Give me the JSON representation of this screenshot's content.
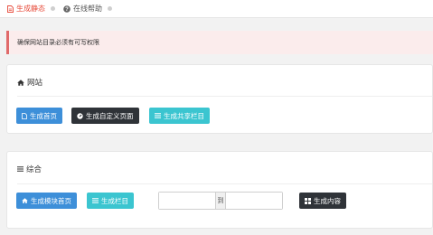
{
  "tabs": {
    "active_label": "生成静态",
    "help_label": "在线帮助"
  },
  "alert": {
    "text": "确保网站目录必须有可写权限"
  },
  "panel_site": {
    "title": "网站",
    "buttons": {
      "home": "生成首页",
      "custom": "生成自定义页面",
      "shared": "生成共享栏目"
    }
  },
  "panel_general": {
    "title": "综合",
    "buttons": {
      "module_home": "生成模块首页",
      "column": "生成栏目",
      "content": "生成内容"
    },
    "range": {
      "from_value": "",
      "to_value": "",
      "separator": "到"
    }
  },
  "colors": {
    "accent_red": "#e74c3c",
    "blue": "#3d8fd9",
    "dark": "#2f3338",
    "cyan": "#3bc5d0"
  }
}
